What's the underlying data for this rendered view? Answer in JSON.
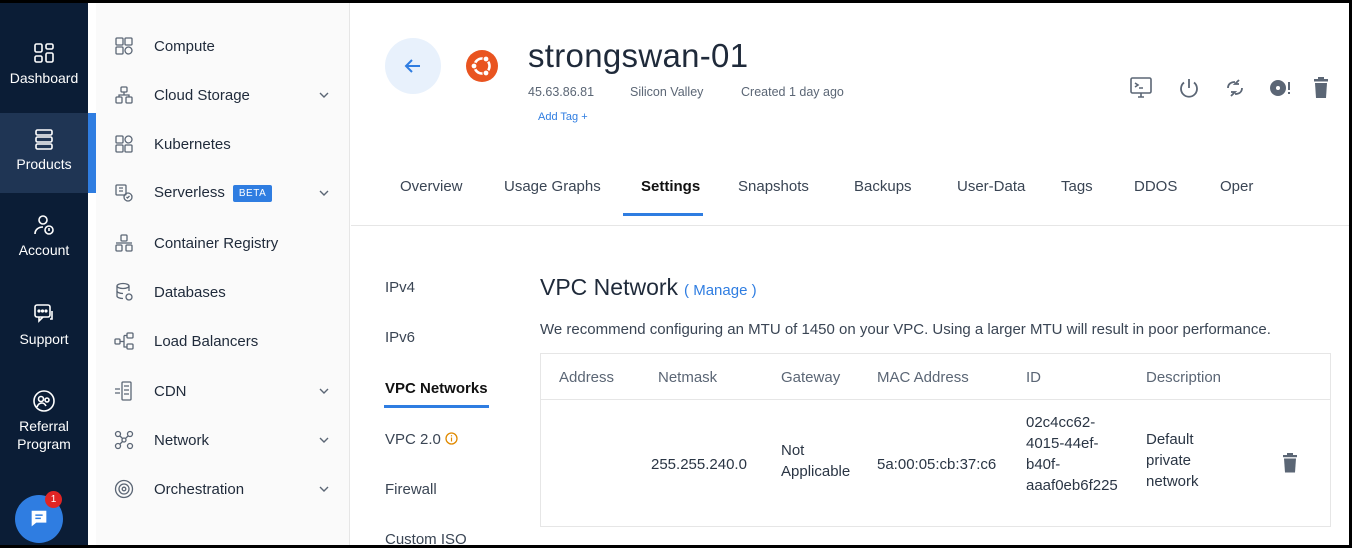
{
  "rail": {
    "items": [
      {
        "label": "Dashboard",
        "icon": "dashboard-icon"
      },
      {
        "label": "Products",
        "icon": "products-icon"
      },
      {
        "label": "Account",
        "icon": "account-icon"
      },
      {
        "label": "Support",
        "icon": "support-icon"
      },
      {
        "label": "Referral Program",
        "icon": "referral-icon"
      }
    ],
    "chat_badge": "1"
  },
  "nav": {
    "items": [
      {
        "label": "Compute",
        "icon": "compute-icon"
      },
      {
        "label": "Cloud Storage",
        "icon": "cloud-storage-icon"
      },
      {
        "label": "Kubernetes",
        "icon": "kubernetes-icon"
      },
      {
        "label": "Serverless",
        "icon": "serverless-icon",
        "badge": "BETA"
      },
      {
        "label": "Container Registry",
        "icon": "container-registry-icon"
      },
      {
        "label": "Databases",
        "icon": "databases-icon"
      },
      {
        "label": "Load Balancers",
        "icon": "load-balancers-icon"
      },
      {
        "label": "CDN",
        "icon": "cdn-icon"
      },
      {
        "label": "Network",
        "icon": "network-icon"
      },
      {
        "label": "Orchestration",
        "icon": "orchestration-icon"
      }
    ]
  },
  "header": {
    "server_name": "strongswan-01",
    "ip": "45.63.86.81",
    "location": "Silicon Valley",
    "created": "Created 1 day ago",
    "add_tag": "Add Tag +",
    "os_icon": "ubuntu-icon"
  },
  "tabs": [
    "Overview",
    "Usage Graphs",
    "Settings",
    "Snapshots",
    "Backups",
    "User-Data",
    "Tags",
    "DDOS",
    "Oper"
  ],
  "active_tab": "Settings",
  "subnav": [
    "IPv4",
    "IPv6",
    "VPC Networks",
    "VPC 2.0",
    "Firewall",
    "Custom ISO"
  ],
  "active_subnav": "VPC Networks",
  "vpc": {
    "title": "VPC Network",
    "manage": "( Manage )",
    "recommendation": "We recommend configuring an MTU of 1450 on your VPC. Using a larger MTU will result in poor performance.",
    "columns": [
      "Address",
      "Netmask",
      "Gateway",
      "MAC Address",
      "ID",
      "Description"
    ],
    "rows": [
      {
        "address": "",
        "netmask": "255.255.240.0",
        "gateway": [
          "Not",
          "Applicable"
        ],
        "mac": "5a:00:05:cb:37:c6",
        "id": [
          "02c4cc62-",
          "4015-44ef-",
          "b40f-",
          "aaaf0eb6f225"
        ],
        "description": [
          "Default",
          "private",
          "network"
        ]
      }
    ]
  },
  "colors": {
    "accent": "#2f7de1",
    "rail_bg": "#0b1d36",
    "ubuntu": "#e95420"
  }
}
